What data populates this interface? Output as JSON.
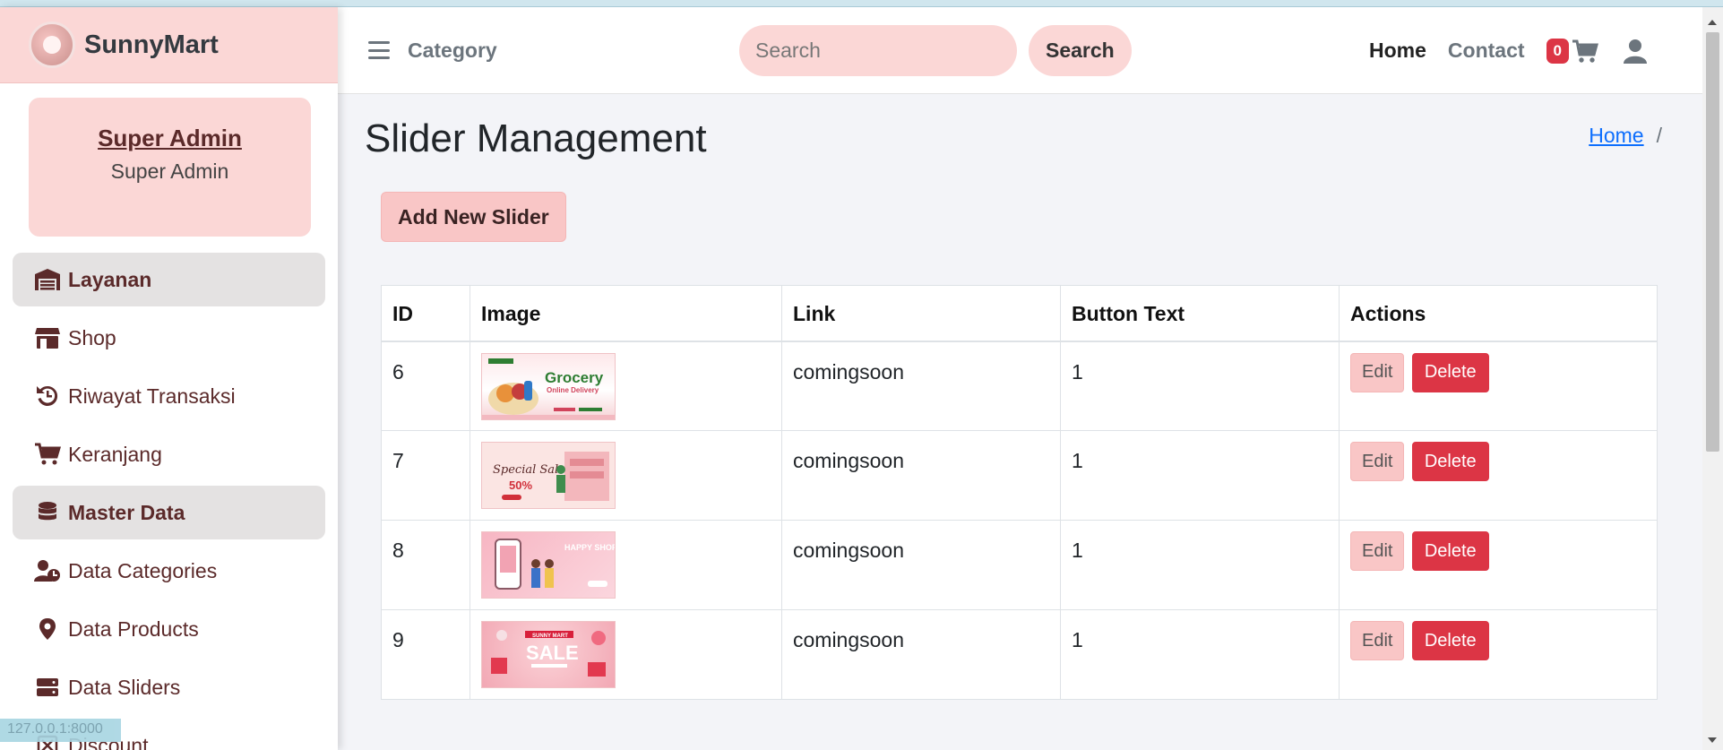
{
  "brand": {
    "name": "SunnyMart"
  },
  "user": {
    "name": "Super Admin",
    "role": "Super Admin"
  },
  "sidebar": {
    "items": [
      {
        "label": "Layanan",
        "icon": "warehouse-icon",
        "section": true
      },
      {
        "label": "Shop",
        "icon": "store-icon",
        "section": false
      },
      {
        "label": "Riwayat Transaksi",
        "icon": "history-icon",
        "section": false
      },
      {
        "label": "Keranjang",
        "icon": "cart-icon",
        "section": false
      },
      {
        "label": "Master Data",
        "icon": "database-icon",
        "section": true
      },
      {
        "label": "Data Categories",
        "icon": "user-clock-icon",
        "section": false
      },
      {
        "label": "Data Products",
        "icon": "map-pin-icon",
        "section": false
      },
      {
        "label": "Data Sliders",
        "icon": "server-icon",
        "section": false
      },
      {
        "label": "Discount",
        "icon": "discount-icon",
        "section": false
      }
    ]
  },
  "statusbar": {
    "url": "127.0.0.1:8000"
  },
  "topbar": {
    "category_label": "Category",
    "search_placeholder": "Search",
    "search_button": "Search",
    "home_link": "Home",
    "contact_link": "Contact",
    "cart_count": "0"
  },
  "page": {
    "title": "Slider Management",
    "breadcrumb_home": "Home",
    "breadcrumb_sep": "/",
    "add_button": "Add New Slider"
  },
  "table": {
    "headers": [
      "ID",
      "Image",
      "Link",
      "Button Text",
      "Actions"
    ],
    "rows": [
      {
        "id": "6",
        "link": "comingsoon",
        "button_text": "1",
        "image_desc": "Grocery Online Delivery banner"
      },
      {
        "id": "7",
        "link": "comingsoon",
        "button_text": "1",
        "image_desc": "Special Sale 50% banner"
      },
      {
        "id": "8",
        "link": "comingsoon",
        "button_text": "1",
        "image_desc": "Happy Shopping banner"
      },
      {
        "id": "9",
        "link": "comingsoon",
        "button_text": "1",
        "image_desc": "Sale banner"
      }
    ],
    "edit_label": "Edit",
    "delete_label": "Delete",
    "banner_texts": {
      "grocery": "Grocery",
      "online": "Online Delivery",
      "special": "Special Sale",
      "fifty": "50%",
      "happy": "HAPPY SHOPPING",
      "sunny": "SUNNY MART",
      "sale": "SALE"
    }
  },
  "colors": {
    "accent": "#fbd7d6",
    "danger": "#dc3545",
    "brand_text": "#5b2a2a"
  }
}
